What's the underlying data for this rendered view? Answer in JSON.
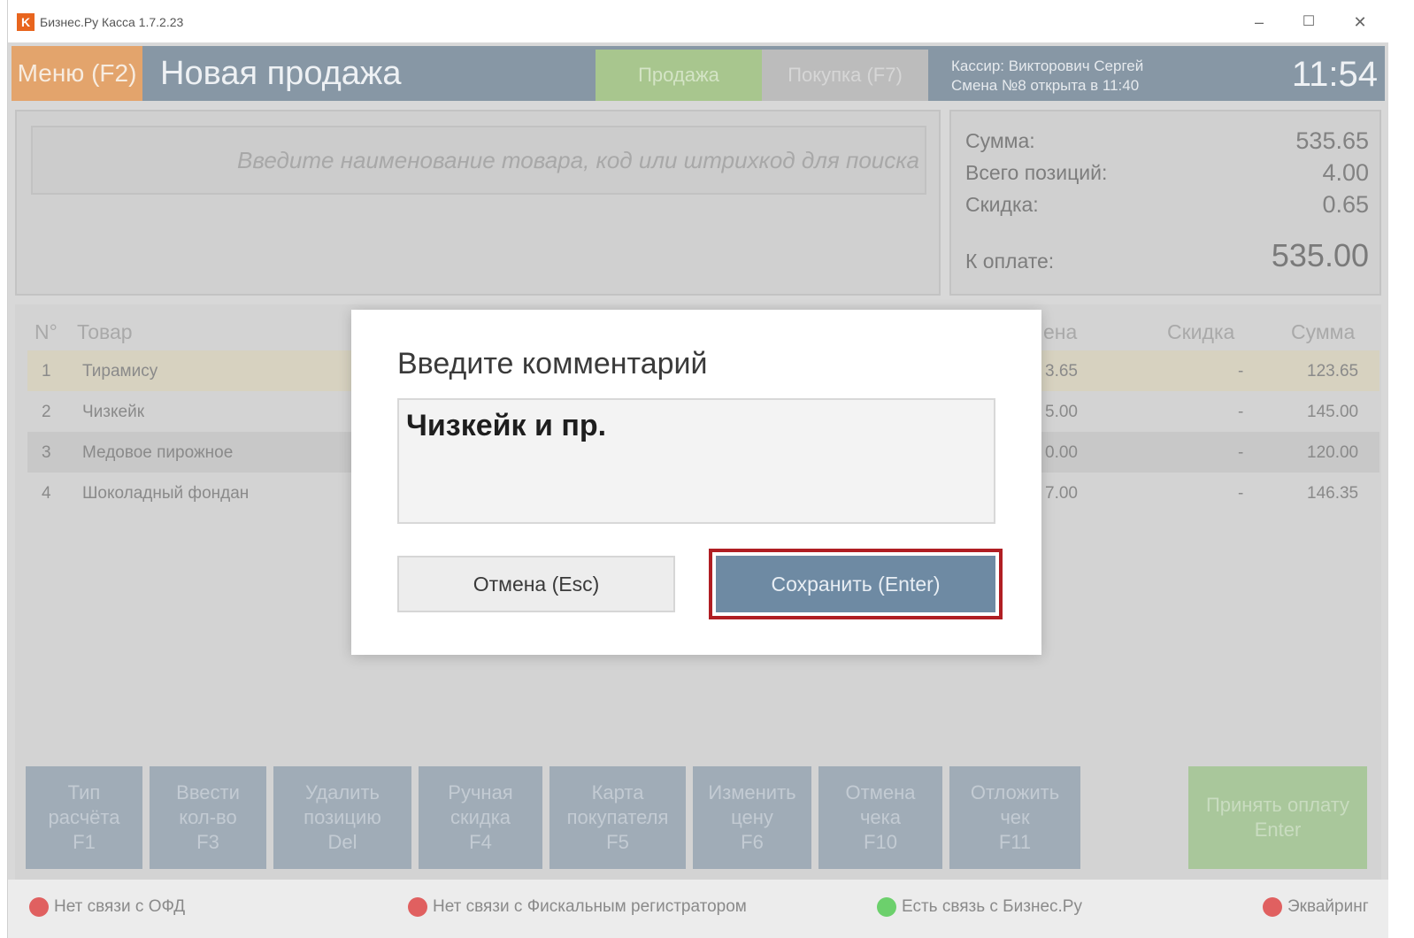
{
  "window": {
    "icon_letter": "K",
    "title": "Бизнес.Ру Касса 1.7.2.23",
    "minimize": "–",
    "maximize": "☐",
    "close": "✕"
  },
  "header": {
    "menu_label": "Меню (F2)",
    "title": "Новая продажа",
    "tab_sale": "Продажа",
    "tab_buy": "Покупка (F7)",
    "cashier": "Кассир: Викторович Сергей",
    "shift": "Смена №8 открыта в 11:40",
    "time": "11:54"
  },
  "search": {
    "placeholder": "Введите наименование товара, код или штрихкод для поиска"
  },
  "totals": {
    "sum_label": "Сумма:",
    "sum_value": "535.65",
    "positions_label": "Всего позиций:",
    "positions_value": "4.00",
    "discount_label": "Скидка:",
    "discount_value": "0.65",
    "topay_label": "К оплате:",
    "topay_value": "535.00"
  },
  "table": {
    "headers": {
      "num": "N°",
      "item": "Товар",
      "price": "ена",
      "discount": "Скидка",
      "sum": "Сумма"
    },
    "rows": [
      {
        "num": "1",
        "item": "Тирамису",
        "price": "3.65",
        "discount": "-",
        "sum": "123.65"
      },
      {
        "num": "2",
        "item": "Чизкейк",
        "price": "5.00",
        "discount": "-",
        "sum": "145.00"
      },
      {
        "num": "3",
        "item": "Медовое пирожное",
        "price": "0.00",
        "discount": "-",
        "sum": "120.00"
      },
      {
        "num": "4",
        "item": "Шоколадный фондан",
        "price": "7.00",
        "discount": "-",
        "sum": "146.35"
      }
    ]
  },
  "function_buttons": [
    {
      "l1": "Тип",
      "l2": "расчёта",
      "l3": "F1"
    },
    {
      "l1": "Ввести",
      "l2": "кол-во",
      "l3": "F3"
    },
    {
      "l1": "Удалить",
      "l2": "позицию",
      "l3": "Del"
    },
    {
      "l1": "Ручная",
      "l2": "скидка",
      "l3": "F4"
    },
    {
      "l1": "Карта",
      "l2": "покупателя",
      "l3": "F5"
    },
    {
      "l1": "Изменить",
      "l2": "цену",
      "l3": "F6"
    },
    {
      "l1": "Отмена",
      "l2": "чека",
      "l3": "F10"
    },
    {
      "l1": "Отложить",
      "l2": "чек",
      "l3": "F11"
    }
  ],
  "pay_button": {
    "l1": "Принять оплату",
    "l2": "Enter"
  },
  "status": {
    "ofd": "Нет связи с ОФД",
    "fiscal": "Нет связи с Фискальным регистратором",
    "business": "Есть связь с Бизнес.Ру",
    "acquiring": "Эквайринг"
  },
  "modal": {
    "title": "Введите комментарий",
    "comment_value": "Чизкейк и пр.",
    "cancel_label": "Отмена (Esc)",
    "save_label": "Сохранить (Enter)"
  }
}
